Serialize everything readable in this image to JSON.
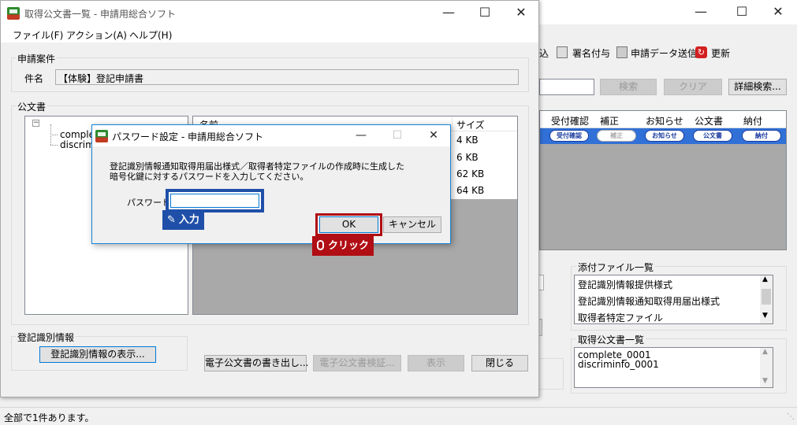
{
  "main_window": {
    "toolbar": {
      "item_partial": "込",
      "sign": "署名付与",
      "send": "申請データ送信",
      "refresh": "更新"
    },
    "search_button": "検索",
    "clear_button": "クリア",
    "detail_search_button": "詳細検索...",
    "table_headers": [
      "受付確認",
      "補正",
      "お知らせ",
      "公文書",
      "納付"
    ],
    "row_buttons": [
      "受付確認",
      "補正",
      "お知らせ",
      "公文書",
      "納付"
    ],
    "attachments_title": "添付ファイル一覧",
    "attachments": [
      "登記識別情報提供様式",
      "登記識別情報通知取得用届出様式",
      "取得者特定ファイル"
    ],
    "documents_title": "取得公文書一覧",
    "documents": [
      "complete_0001",
      "discriminfo_0001"
    ],
    "status_text": "全部で1件あります。"
  },
  "doc_window": {
    "title": "取得公文書一覧 - 申請用総合ソフト",
    "menu": [
      "ファイル(F)",
      "アクション(A)",
      "ヘルプ(H)"
    ],
    "case_group": "申請案件",
    "subject_label": "件名",
    "subject_value": "【体験】登記申請書",
    "docs_group": "公文書",
    "tree_items": [
      "complet",
      "discrimi"
    ],
    "file_headers": [
      "名前",
      "サイズ"
    ],
    "file_sizes": [
      "4 KB",
      "6 KB",
      "62 KB",
      "64 KB"
    ],
    "ident_group": "登記識別情報",
    "show_ident_button": "登記識別情報の表示...",
    "export_button": "電子公文書の書き出し...",
    "verify_button": "電子公文書検証...",
    "display_button": "表示",
    "close_button": "閉じる"
  },
  "dialog": {
    "title": "パスワード設定 - 申請用総合ソフト",
    "message_line1": "登記識別情報通知取得用届出様式／取得者特定ファイルの作成時に生成した",
    "message_line2": "暗号化鍵に対するパスワードを入力してください。",
    "password_label": "パスワード",
    "password_value": "",
    "ok_button": "OK",
    "cancel_button": "キャンセル"
  },
  "annotations": {
    "input_callout": "入力",
    "click_callout": "クリック",
    "input_color": "#1f4fa8",
    "click_color": "#b00d14"
  }
}
